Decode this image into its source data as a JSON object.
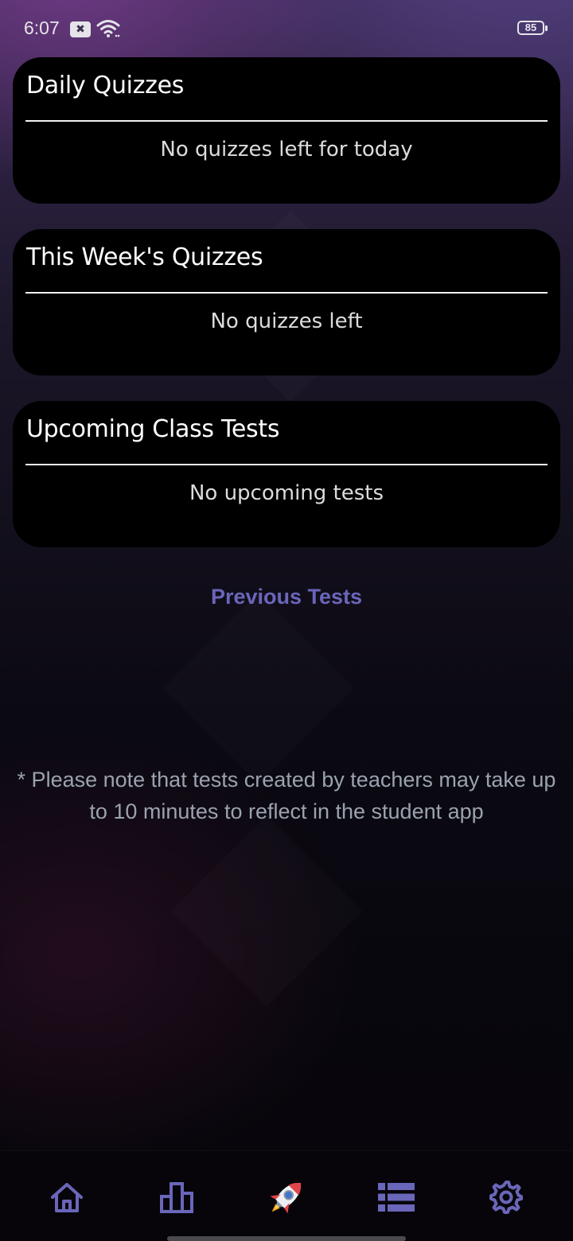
{
  "status_bar": {
    "time": "6:07",
    "notification_glyph": "✖",
    "battery_level": "85"
  },
  "cards": [
    {
      "title": "Daily Quizzes",
      "empty_text": "No quizzes left for today"
    },
    {
      "title": "This Week's Quizzes",
      "empty_text": "No quizzes left"
    },
    {
      "title": "Upcoming Class Tests",
      "empty_text": "No upcoming tests"
    }
  ],
  "previous_tests_link": "Previous Tests",
  "note": "* Please note that tests created by teachers may take up to 10 minutes to reflect in the student app",
  "bottom_nav": {
    "items": [
      {
        "icon": "home-icon"
      },
      {
        "icon": "leaderboard-icon"
      },
      {
        "icon": "rocket-icon"
      },
      {
        "icon": "list-icon"
      },
      {
        "icon": "settings-icon"
      }
    ]
  },
  "colors": {
    "accent": "#6a66b9",
    "card_background": "#000000",
    "note_text": "#9aa3ad"
  }
}
